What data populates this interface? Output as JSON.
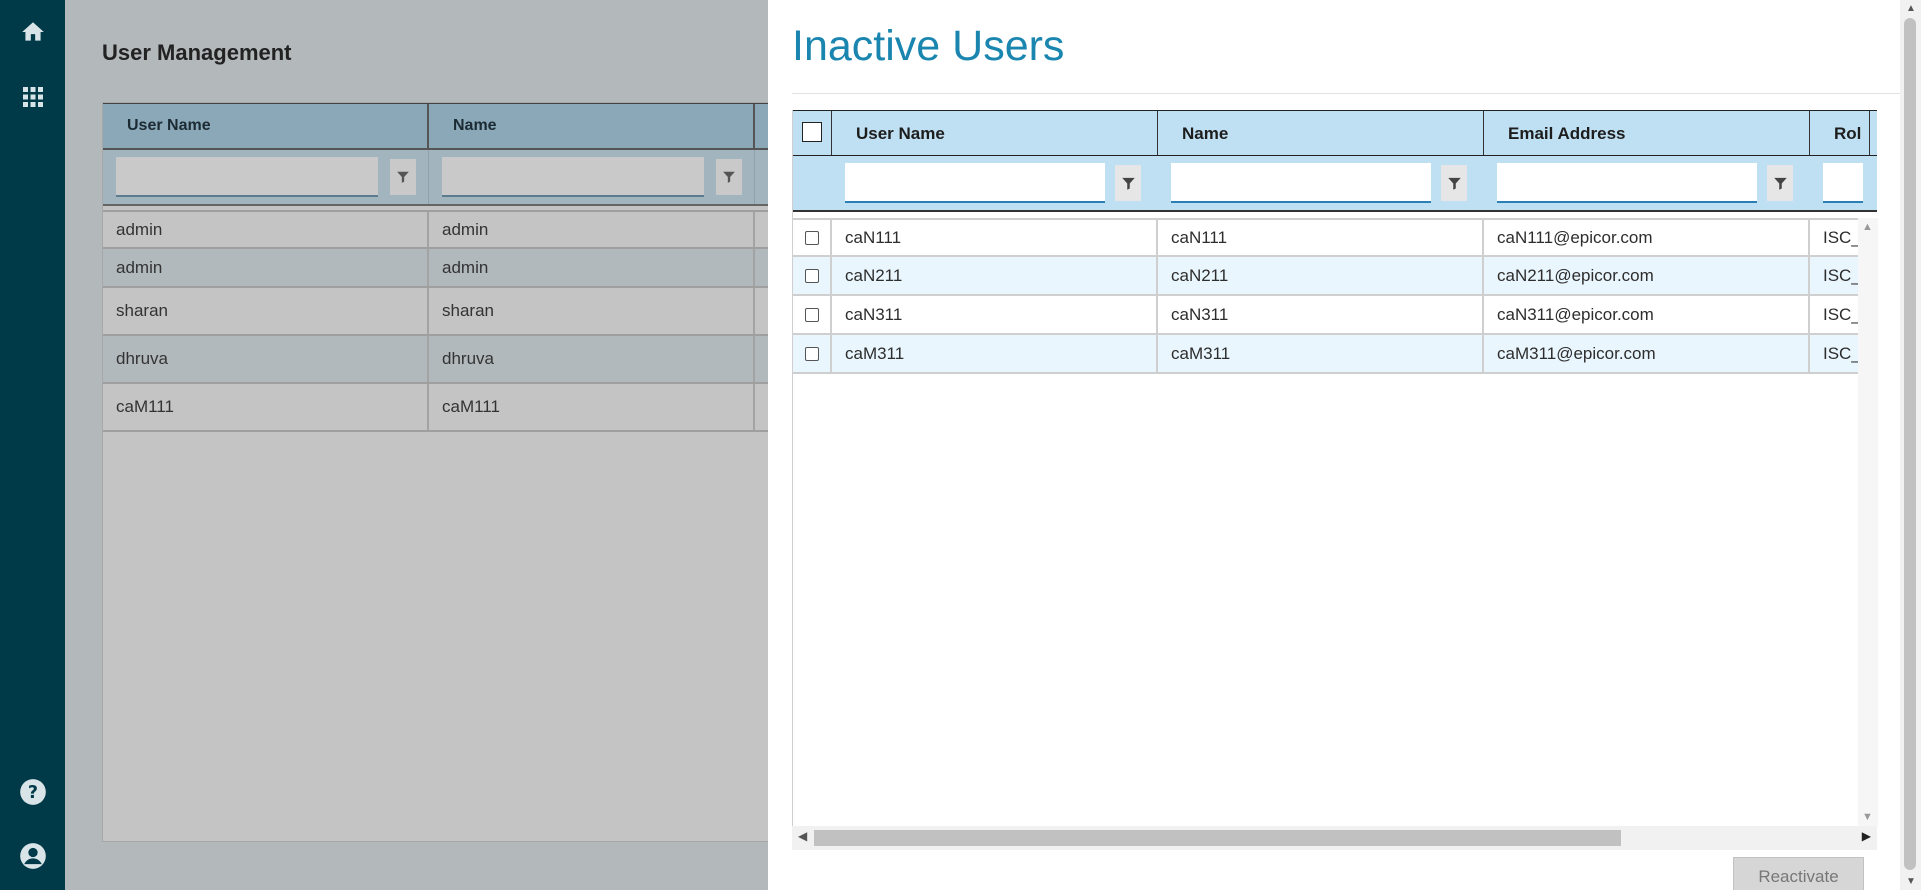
{
  "nav": {
    "items": [
      {
        "icon": "home-icon"
      },
      {
        "icon": "apps-grid-icon"
      },
      {
        "icon": "help-icon"
      },
      {
        "icon": "user-account-icon"
      }
    ]
  },
  "background": {
    "title": "User Management",
    "columns": [
      "User Name",
      "Name"
    ],
    "rows": [
      [
        "admin",
        "admin"
      ],
      [
        "admin",
        "admin"
      ],
      [
        "sharan",
        "sharan"
      ],
      [
        "dhruva",
        "dhruva"
      ],
      [
        "caM111",
        "caM111"
      ]
    ]
  },
  "dialog": {
    "title": "Inactive Users",
    "columns": [
      "User Name",
      "Name",
      "Email Address",
      "Rol"
    ],
    "filters": [
      "",
      "",
      "",
      ""
    ],
    "rows": [
      [
        "caN111",
        "caN111",
        "caN111@epicor.com",
        "ISC_"
      ],
      [
        "caN211",
        "caN211",
        "caN211@epicor.com",
        "ISC_"
      ],
      [
        "caN311",
        "caN311",
        "caN311@epicor.com",
        "ISC_"
      ],
      [
        "caM311",
        "caM311",
        "caM311@epicor.com",
        "ISC_"
      ]
    ],
    "reactivate_label": "Reactivate"
  },
  "colors": {
    "rail": "#003a48",
    "title_accent": "#1a86b0",
    "header_bg": "#bfe0f2",
    "alt_row": "#eaf6fd"
  }
}
